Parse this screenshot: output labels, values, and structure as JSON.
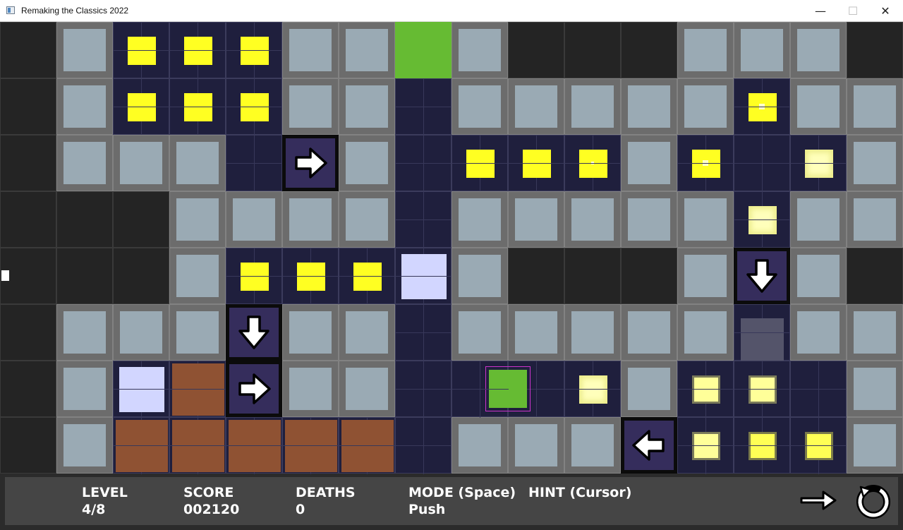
{
  "window": {
    "title": "Remaking the Classics 2022",
    "minimize": "—",
    "maximize": "☐",
    "close": "✕"
  },
  "board": {
    "columns": 16,
    "rows": 8,
    "legend": {
      "E": "empty",
      "W": "wall",
      "F": "floor",
      "X": "exit",
      "A": "arrow"
    },
    "rows_layout": [
      [
        "E",
        "W",
        "F",
        "F",
        "F",
        "W",
        "W",
        "X",
        "W",
        "E",
        "E",
        "E",
        "W",
        "W",
        "W",
        "E"
      ],
      [
        "E",
        "W",
        "F",
        "F",
        "F",
        "W",
        "W",
        "F",
        "W",
        "W",
        "W",
        "W",
        "W",
        "F",
        "W",
        "W"
      ],
      [
        "E",
        "W",
        "W",
        "W",
        "F",
        "A",
        "W",
        "F",
        "F",
        "F",
        "F",
        "W",
        "F",
        "F",
        "F",
        "W"
      ],
      [
        "E",
        "E",
        "E",
        "W",
        "W",
        "W",
        "W",
        "F",
        "W",
        "W",
        "W",
        "W",
        "W",
        "F",
        "W",
        "W"
      ],
      [
        "E",
        "E",
        "E",
        "W",
        "F",
        "F",
        "F",
        "F",
        "W",
        "E",
        "E",
        "E",
        "W",
        "A",
        "W",
        "E"
      ],
      [
        "E",
        "W",
        "W",
        "W",
        "A",
        "W",
        "W",
        "F",
        "W",
        "W",
        "W",
        "W",
        "W",
        "F",
        "W",
        "W"
      ],
      [
        "E",
        "W",
        "F",
        "F",
        "A",
        "W",
        "W",
        "F",
        "F",
        "F",
        "F",
        "W",
        "F",
        "F",
        "F",
        "W"
      ],
      [
        "E",
        "W",
        "F",
        "F",
        "F",
        "F",
        "F",
        "F",
        "W",
        "W",
        "W",
        "A",
        "F",
        "F",
        "F",
        "W"
      ]
    ],
    "arrows": [
      {
        "row": 2,
        "col": 5,
        "direction": "right",
        "icon": "right-arrow-icon"
      },
      {
        "row": 4,
        "col": 13,
        "direction": "down",
        "icon": "down-arrow-icon"
      },
      {
        "row": 5,
        "col": 4,
        "direction": "down",
        "icon": "down-arrow-icon"
      },
      {
        "row": 6,
        "col": 4,
        "direction": "right",
        "icon": "right-arrow-icon"
      },
      {
        "row": 7,
        "col": 11,
        "direction": "left",
        "icon": "left-arrow-icon"
      }
    ],
    "pellets": [
      {
        "row": 0,
        "col": 2,
        "style": "plain"
      },
      {
        "row": 0,
        "col": 3,
        "style": "plain"
      },
      {
        "row": 0,
        "col": 4,
        "style": "plain"
      },
      {
        "row": 1,
        "col": 2,
        "style": "plain"
      },
      {
        "row": 1,
        "col": 3,
        "style": "plain"
      },
      {
        "row": 1,
        "col": 4,
        "style": "plain"
      },
      {
        "row": 1,
        "col": 13,
        "style": "dot"
      },
      {
        "row": 2,
        "col": 8,
        "style": "plain"
      },
      {
        "row": 2,
        "col": 9,
        "style": "plain"
      },
      {
        "row": 2,
        "col": 10,
        "style": "small"
      },
      {
        "row": 2,
        "col": 12,
        "style": "dot"
      },
      {
        "row": 2,
        "col": 14,
        "style": "glow"
      },
      {
        "row": 3,
        "col": 13,
        "style": "glow"
      },
      {
        "row": 4,
        "col": 4,
        "style": "plain"
      },
      {
        "row": 4,
        "col": 5,
        "style": "plain"
      },
      {
        "row": 4,
        "col": 6,
        "style": "plain"
      },
      {
        "row": 6,
        "col": 10,
        "style": "glow"
      },
      {
        "row": 6,
        "col": 12,
        "style": "ringpale"
      },
      {
        "row": 6,
        "col": 13,
        "style": "ringpale"
      },
      {
        "row": 7,
        "col": 12,
        "style": "ringpale"
      },
      {
        "row": 7,
        "col": 13,
        "style": "ring"
      },
      {
        "row": 7,
        "col": 14,
        "style": "ring"
      }
    ],
    "lavender_blocks": [
      {
        "row": 4,
        "col": 7
      },
      {
        "row": 6,
        "col": 2
      }
    ],
    "bricks": [
      {
        "row": 6,
        "col": 3
      },
      {
        "row": 7,
        "col": 2
      },
      {
        "row": 7,
        "col": 3
      },
      {
        "row": 7,
        "col": 4
      },
      {
        "row": 7,
        "col": 5
      },
      {
        "row": 7,
        "col": 6
      }
    ],
    "player": {
      "row": 6,
      "col": 8
    },
    "slate_blocks": [
      {
        "row": 5,
        "col": 13
      }
    ],
    "colors": {
      "exit": "#66bb33",
      "pellet": "#ffff22",
      "brick": "#8f5233",
      "lavender": "#d2d6ff",
      "player": "#66bb33",
      "player_outline": "#cc33cc"
    }
  },
  "hud": {
    "level_label": "LEVEL",
    "level_value": "4/8",
    "score_label": "SCORE",
    "score_value": "002120",
    "deaths_label": "DEATHS",
    "deaths_value": "0",
    "mode_label": "MODE (Space)",
    "mode_value": "Push",
    "hint_label": "HINT (Cursor)",
    "next_icon": "right-arrow-icon",
    "restart_icon": "restart-icon"
  }
}
